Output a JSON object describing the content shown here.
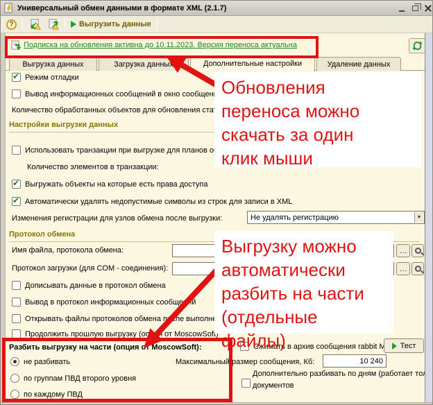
{
  "window": {
    "title": "Универсальный обмен данными в формате XML (2.1.7)"
  },
  "toolbar": {
    "help_label": "?",
    "run_label": "Выгрузить данные"
  },
  "subscription": {
    "link_text": "Подписка на обновления активна до 10.11.2023. Версия переноса актуальна"
  },
  "tabs": {
    "items": [
      {
        "label": "Выгрузка данных"
      },
      {
        "label": "Загрузка данных"
      },
      {
        "label": "Дополнительные настройки"
      },
      {
        "label": "Удаление данных"
      }
    ],
    "active": "Дополнительные настройки"
  },
  "form": {
    "debug_mode": "Режим отладки",
    "info_messages": "Вывод информационных сообщений в окно сообщений",
    "processed_objects": "Количество обработанных объектов для обновления стат",
    "export_settings_header": "Настройки выгрузки данных",
    "use_transactions": "Использовать транзакции при выгрузке для планов обмена",
    "items_in_transaction": "Количество элементов в транзакции:",
    "export_with_rights": "Выгружать объекты на которые есть права доступа",
    "auto_remove_invalid": "Автоматически удалять недопустимые символы из строк для записи в XML",
    "registration_changes_label": "Изменения регистрации для узлов обмена после выгрузки:",
    "registration_changes_value": "Не удалять регистрацию",
    "protocol_header": "Протокол обмена",
    "protocol_file_label": "Имя файла, протокола обмена:",
    "protocol_com_label": "Протокол загрузки (для COM - соединения):",
    "append_protocol": "Дописывать данные в протокол обмена",
    "protocol_info_messages": "Вывод в протокол информационных сообщений",
    "open_protocol_files": "Открывать файлы протоколов обмена после выполнени",
    "continue_last_export": "Продолжить прошлую выгрузку (опция от MoscowSoft)",
    "split_header": "Разбить выгрузку на части (опция от MoscowSoft):",
    "split_options": [
      "не разбивать",
      "по группам ПВД второго уровня",
      "по каждому ПВД"
    ],
    "compress_label": "Сжимать в архив сообщения rabbit M",
    "test_button": "Тест",
    "max_size_label": "Максимальный размер сообщения, Кб:",
    "max_size_value": "10 240",
    "split_by_days_line1": "Дополнительно разбивать по дням (работает только для выгрузки",
    "split_by_days_line2": "документов",
    "ellipsis_button": "…"
  },
  "annotations": {
    "note1_lines": [
      "Обновления",
      "переноса можно",
      "скачать за один",
      "клик мыши"
    ],
    "note2_lines": [
      "Выгрузку можно",
      "автоматически",
      "разбить на части",
      "(отдельные файлы)"
    ],
    "accent_red": "#e01212",
    "link_green": "#1c871c",
    "header_olive": "#8a7300"
  }
}
